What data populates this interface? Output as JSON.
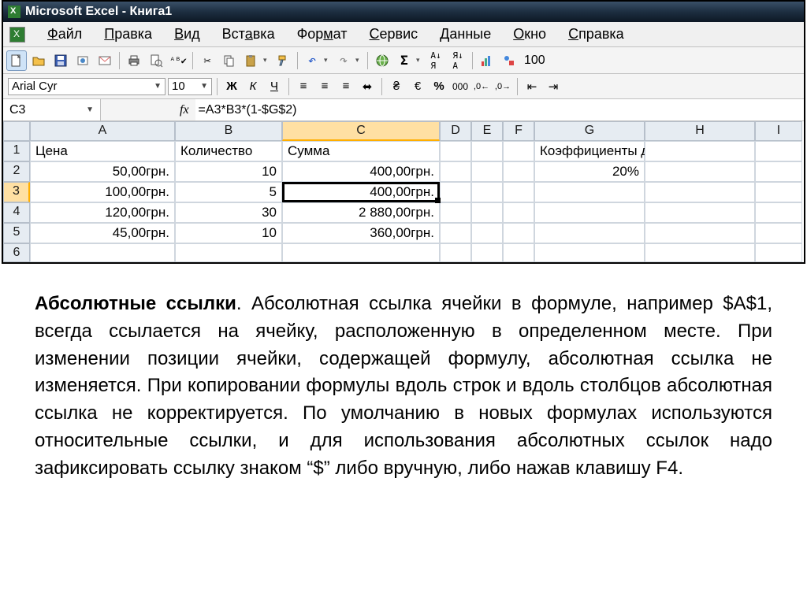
{
  "title": "Microsoft Excel - Книга1",
  "menu": [
    "Файл",
    "Правка",
    "Вид",
    "Вставка",
    "Формат",
    "Сервис",
    "Данные",
    "Окно",
    "Справка"
  ],
  "menu_accel": [
    "Ф",
    "П",
    "В",
    "В",
    "Ф",
    "С",
    "Д",
    "О",
    "С"
  ],
  "font_name": "Arial Cyr",
  "font_size": "10",
  "name_box": "C3",
  "fx_label": "fx",
  "formula": "=A3*B3*(1-$G$2)",
  "zoom": "100",
  "columns": [
    "A",
    "B",
    "C",
    "D",
    "E",
    "F",
    "G",
    "H",
    "I"
  ],
  "row_labels": [
    "1",
    "2",
    "3",
    "4",
    "5",
    "6"
  ],
  "selected_col": "C",
  "selected_row": "3",
  "headers": {
    "A": "Цена",
    "B": "Количество",
    "C": "Сумма",
    "G": "Коэффициенты дисконта"
  },
  "rows": [
    {
      "A": "50,00грн.",
      "B": "10",
      "C": "400,00грн.",
      "G": "20%"
    },
    {
      "A": "100,00грн.",
      "B": "5",
      "C": "400,00грн.",
      "G": ""
    },
    {
      "A": "120,00грн.",
      "B": "30",
      "C": "2 880,00грн.",
      "G": ""
    },
    {
      "A": "45,00грн.",
      "B": "10",
      "C": "360,00грн.",
      "G": ""
    }
  ],
  "essay_bold": "Абсолютные ссылки",
  "essay_text": ". Абсолютная ссылка ячейки в формуле, например $A$1, всегда ссылается на ячейку, расположенную в определенном месте. При изменении позиции ячейки, содержащей формулу, абсолютная ссылка не изменяется. При копировании формулы вдоль строк и вдоль столбцов абсолютная ссылка не корректируется. По умолчанию в новых формулах используются относительные ссылки, и для использования абсолютных ссылок надо зафиксировать ссылку знаком “$” либо вручную, либо нажав клавишу F4."
}
